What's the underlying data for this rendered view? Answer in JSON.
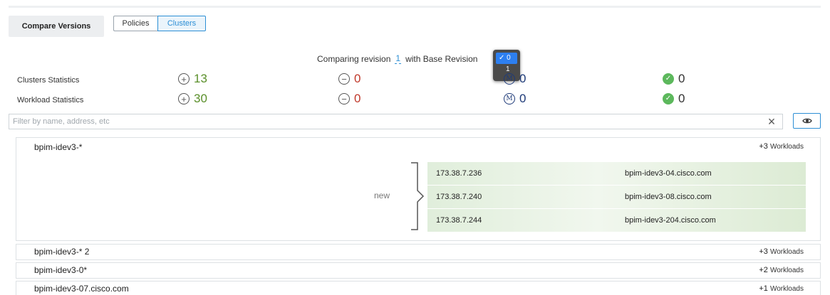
{
  "toolbar": {
    "compare_label": "Compare Versions",
    "tabs": [
      {
        "label": "Policies",
        "selected": false
      },
      {
        "label": "Clusters",
        "selected": true
      }
    ]
  },
  "revision": {
    "prefix": "Comparing revision",
    "value": "1",
    "suffix": "with Base Revision",
    "dropdown_options": [
      {
        "label": "0",
        "selected": true
      },
      {
        "label": "1",
        "selected": false
      }
    ]
  },
  "stats": {
    "clusters": {
      "label": "Clusters Statistics",
      "added": "13",
      "removed": "0",
      "modified": "0",
      "unchanged": "0"
    },
    "workloads": {
      "label": "Workload Statistics",
      "added": "30",
      "removed": "0",
      "modified": "0",
      "unchanged": "0"
    }
  },
  "filter": {
    "placeholder": "Filter by name, address, etc"
  },
  "groups": [
    {
      "name": "bpim-idev3-*",
      "count": "+3",
      "count_label": "Workloads",
      "expanded": true,
      "status": "new",
      "workloads": [
        {
          "ip": "173.38.7.236",
          "host": "bpim-idev3-04.cisco.com"
        },
        {
          "ip": "173.38.7.240",
          "host": "bpim-idev3-08.cisco.com"
        },
        {
          "ip": "173.38.7.244",
          "host": "bpim-idev3-204.cisco.com"
        }
      ]
    },
    {
      "name": "bpim-idev3-* 2",
      "count": "+3",
      "count_label": "Workloads"
    },
    {
      "name": "bpim-idev3-0*",
      "count": "+2",
      "count_label": "Workloads"
    },
    {
      "name": "bpim-idev3-07.cisco.com",
      "count": "+1",
      "count_label": "Workloads"
    }
  ],
  "colors": {
    "accent": "#2d8fd5",
    "added": "#5a8f2a",
    "removed": "#c0392b",
    "modified": "#1e3a78",
    "ok": "#5cb85c"
  },
  "icons": {
    "added": "plus-circle-icon",
    "removed": "minus-circle-icon",
    "modified": "m-circle-icon",
    "unchanged": "check-circle-icon"
  }
}
